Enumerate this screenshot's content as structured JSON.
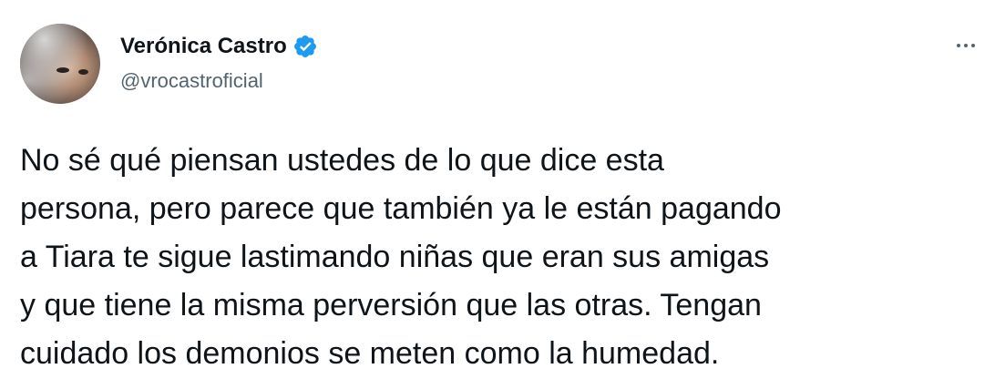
{
  "tweet": {
    "author": {
      "display_name": "Verónica Castro",
      "handle": "@vrocastroficial",
      "verified": true,
      "verified_icon": "verified-badge-icon",
      "verified_color": "#1d9bf0"
    },
    "more_icon": "more-horizontal-icon",
    "text_lines": [
      "No sé qué piensan ustedes de lo que dice esta",
      "persona, pero parece que también ya le están pagando",
      "a Tiara te sigue lastimando niñas que eran sus amigas",
      "y que tiene la misma perversión que las otras. Tengan",
      "cuidado los demonios se meten como la humedad."
    ]
  },
  "colors": {
    "text_primary": "#0f1419",
    "text_secondary": "#536471",
    "accent": "#1d9bf0",
    "background": "#ffffff"
  }
}
